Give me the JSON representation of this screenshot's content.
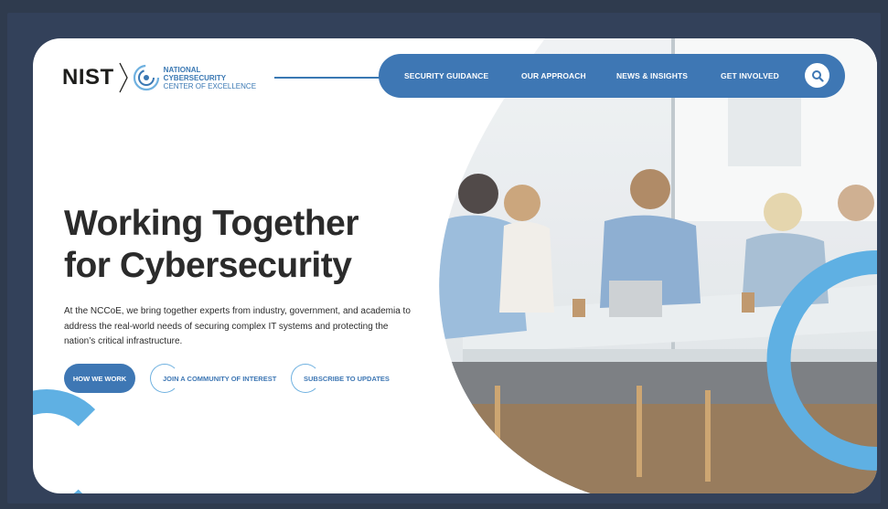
{
  "header": {
    "logo": {
      "nist": "NIST",
      "line1": "NATIONAL",
      "line2": "CYBERSECURITY",
      "line3": "CENTER OF EXCELLENCE"
    },
    "nav": [
      {
        "label": "SECURITY GUIDANCE"
      },
      {
        "label": "OUR APPROACH"
      },
      {
        "label": "NEWS & INSIGHTS"
      },
      {
        "label": "GET INVOLVED"
      }
    ],
    "search_icon": "search-icon"
  },
  "hero": {
    "title_line1": "Working Together",
    "title_line2": "for Cybersecurity",
    "body": "At the NCCoE, we bring together experts from industry, government, and academia to address the real-world needs of securing complex IT systems and protecting the nation’s critical infrastructure.",
    "buttons": {
      "primary": "HOW WE WORK",
      "community": "JOIN A COMMUNITY OF INTEREST",
      "subscribe": "SUBSCRIBE TO UPDATES"
    }
  },
  "colors": {
    "accent": "#3e77b4",
    "light_accent": "#5fb0e3",
    "frame": "#33415a"
  }
}
